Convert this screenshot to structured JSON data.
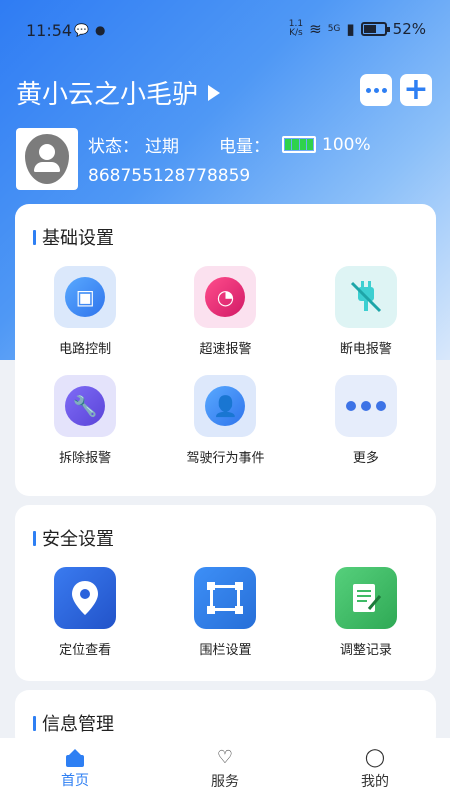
{
  "status_bar": {
    "time": "11:54",
    "net_speed_top": "1.1",
    "net_speed_bottom": "K/s",
    "signal_label": "5G",
    "battery": "52%"
  },
  "header": {
    "title": "黄小云之小毛驴"
  },
  "device": {
    "status_label": "状态：",
    "status_value": "过期",
    "power_label": "电量：",
    "power_value": "100%",
    "id": "868755128778859"
  },
  "basic_settings": {
    "title": "基础设置",
    "items": [
      {
        "label": "电路控制"
      },
      {
        "label": "超速报警"
      },
      {
        "label": "断电报警"
      },
      {
        "label": "拆除报警"
      },
      {
        "label": "驾驶行为事件"
      },
      {
        "label": "更多"
      }
    ]
  },
  "safety_settings": {
    "title": "安全设置",
    "items": [
      {
        "label": "定位查看"
      },
      {
        "label": "围栏设置"
      },
      {
        "label": "调整记录"
      }
    ]
  },
  "info_management": {
    "title": "信息管理"
  },
  "bottom_nav": {
    "items": [
      {
        "label": "首页"
      },
      {
        "label": "服务"
      },
      {
        "label": "我的"
      }
    ]
  },
  "colors": {
    "accent": "#2e7ff3",
    "battery_green": "#2fd24b"
  }
}
